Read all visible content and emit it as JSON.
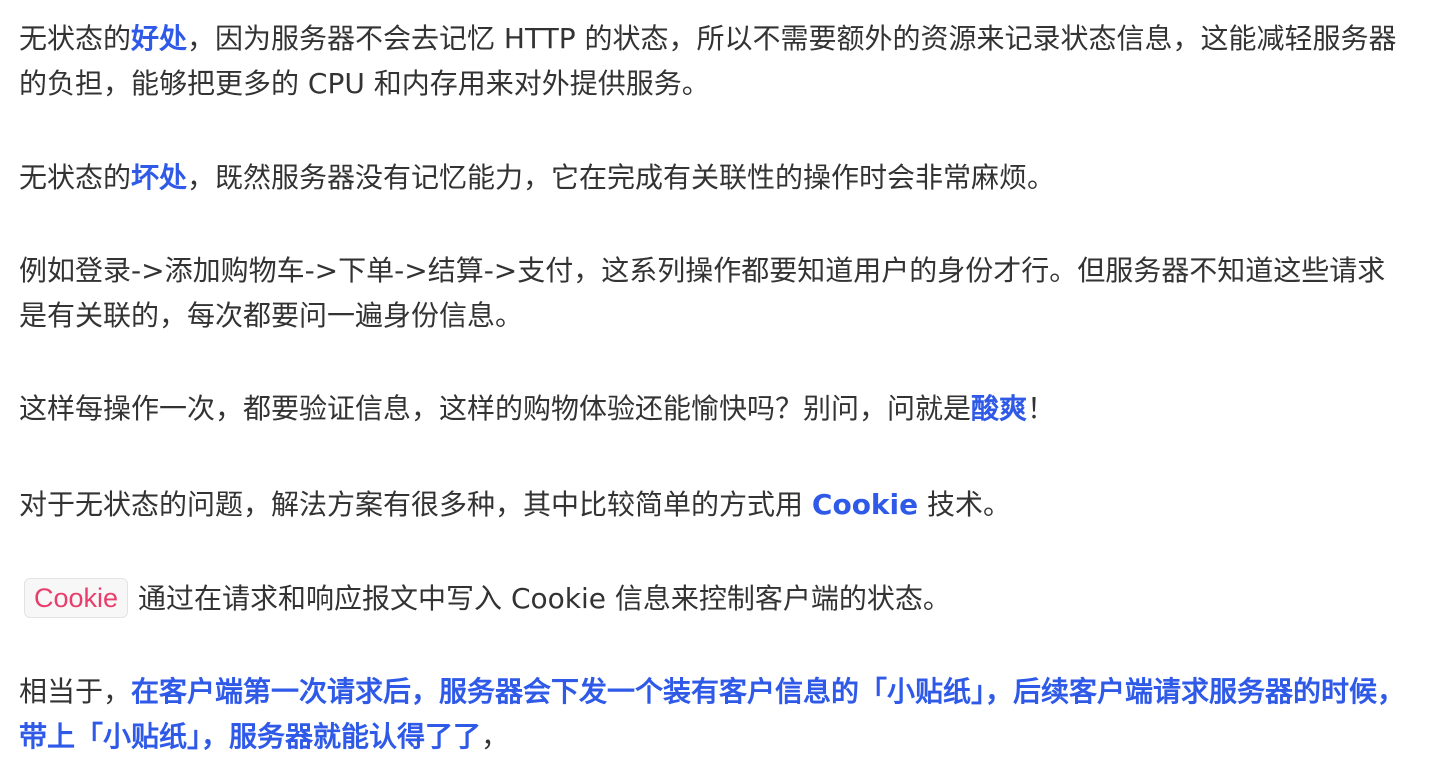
{
  "paragraphs": {
    "p1": {
      "pre": "无状态的",
      "hl": "好处",
      "post": "，因为服务器不会去记忆 HTTP 的状态，所以不需要额外的资源来记录状态信息，这能减轻服务器的负担，能够把更多的 CPU 和内存用来对外提供服务。"
    },
    "p2": {
      "pre": "无状态的",
      "hl": "坏处",
      "post": "，既然服务器没有记忆能力，它在完成有关联性的操作时会非常麻烦。"
    },
    "p3": {
      "text": "例如登录->添加购物车->下单->结算->支付，这系列操作都要知道用户的身份才行。但服务器不知道这些请求是有关联的，每次都要问一遍身份信息。"
    },
    "p4": {
      "pre": "这样每操作一次，都要验证信息，这样的购物体验还能愉快吗？别问，问就是",
      "hl": "酸爽",
      "post": "！"
    },
    "p5": {
      "pre": "对于无状态的问题，解法方案有很多种，其中比较简单的方式用 ",
      "hl": "Cookie",
      "post": " 技术。"
    },
    "p6": {
      "code": "Cookie",
      "post": "通过在请求和响应报文中写入 Cookie 信息来控制客户端的状态。"
    },
    "p7": {
      "pre": "相当于，",
      "hl": "在客户端第一次请求后，服务器会下发一个装有客户信息的「小贴纸」，后续客户端请求服务器的时候，带上「小贴纸」，服务器就能认得了了",
      "post": "，"
    }
  },
  "colors": {
    "text": "#333333",
    "highlight": "#2f5ae8",
    "code_text": "#e83e6b",
    "code_bg": "#f7f7f8"
  }
}
